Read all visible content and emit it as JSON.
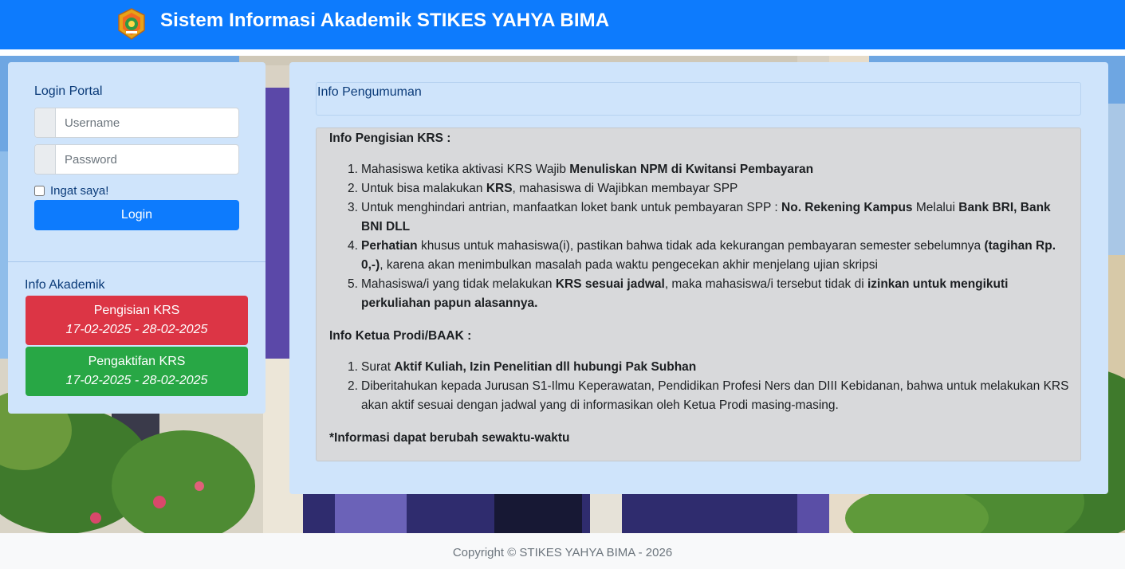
{
  "header": {
    "title": "Sistem Informasi Akademik STIKES YAHYA BIMA",
    "brand_color": "#0d7bfd",
    "logo_icon": "campus-crest-logo"
  },
  "login": {
    "title": "Login Portal",
    "username_placeholder": "Username",
    "password_placeholder": "Password",
    "remember_label": "Ingat saya!",
    "remember_checked": false,
    "submit_label": "Login"
  },
  "akademik": {
    "title": "Info Akademik",
    "items": [
      {
        "label": "Pengisian KRS",
        "dates": "17-02-2025 - 28-02-2025",
        "color": "#dc3545"
      },
      {
        "label": "Pengaktifan KRS",
        "dates": "17-02-2025 - 28-02-2025",
        "color": "#28a745"
      }
    ]
  },
  "pengumuman": {
    "title": "Info Pengumuman",
    "krs_heading": "Info Pengisian KRS :",
    "krs_items": [
      {
        "num": "1.",
        "parts": [
          "Mahasiswa ketika aktivasi KRS Wajib ",
          "Menuliskan NPM di Kwitansi Pembayaran"
        ]
      },
      {
        "num": "2.",
        "parts": [
          "Untuk bisa malakukan ",
          "KRS",
          ", mahasiswa di Wajibkan membayar SPP"
        ]
      },
      {
        "num": "3.",
        "parts": [
          "Untuk menghindari antrian, manfaatkan loket bank untuk pembayaran SPP : ",
          "No. Rekening Kampus",
          " Melalui ",
          "Bank BRI, Bank BNI DLL"
        ]
      },
      {
        "num": "4.",
        "parts": [
          "Perhatian",
          " khusus untuk mahasiswa(i), pastikan bahwa tidak ada kekurangan pembayaran semester sebelumnya ",
          "(tagihan Rp. 0,-)",
          ", karena akan menimbulkan masalah pada waktu pengecekan akhir menjelang ujian skripsi"
        ]
      },
      {
        "num": "5.",
        "parts": [
          "Mahasiswa/i yang tidak melakukan ",
          "KRS sesuai jadwal",
          ", maka mahasiswa/i tersebut tidak di ",
          "izinkan untuk mengikuti perkuliahan papun alasannya."
        ]
      }
    ],
    "prodi_heading": "Info Ketua Prodi/BAAK :",
    "prodi_items": [
      {
        "num": "1.",
        "parts": [
          "Surat ",
          "Aktif Kuliah, Izin Penelitian dll hubungi Pak Subhan"
        ]
      },
      {
        "num": "2.",
        "parts": [
          "Diberitahukan kepada Jurusan S1-Ilmu Keperawatan, Pendidikan Profesi Ners dan DIII Kebidanan, bahwa untuk melakukan KRS akan aktif sesuai dengan jadwal yang di informasikan oleh Ketua Prodi masing-masing."
        ]
      }
    ],
    "note": "*Informasi dapat berubah sewaktu-waktu"
  },
  "footer": {
    "copyright": "Copyright © STIKES YAHYA BIMA - 2026"
  }
}
